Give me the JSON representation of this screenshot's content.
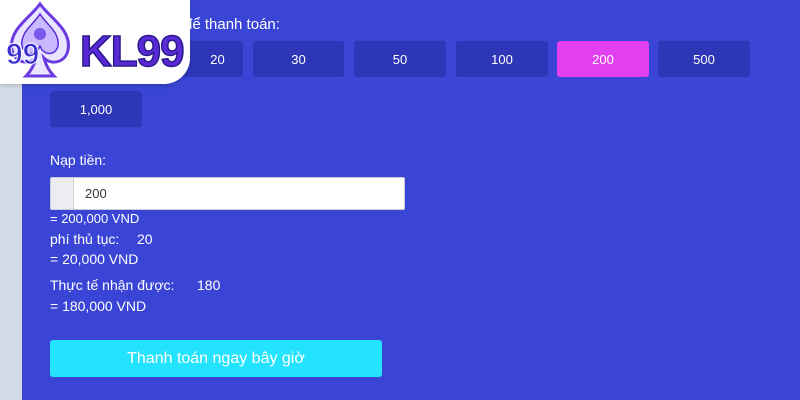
{
  "logo": {
    "brand_text": "KL99",
    "badge_text": "99"
  },
  "payment": {
    "section_title": "để thanh toán:",
    "amount_options": [
      "20",
      "30",
      "50",
      "100",
      "200",
      "500",
      "1,000"
    ],
    "selected_amount": "200"
  },
  "deposit": {
    "label": "Nạp tiền:",
    "input_value": "200",
    "converted": "= 200,000 VND"
  },
  "fee": {
    "label": "phí thủ tục:",
    "value": "20",
    "converted": "= 20,000 VND"
  },
  "received": {
    "label": "Thực tế nhận được:",
    "value": "180",
    "converted": "= 180,000 VND"
  },
  "pay_button_label": "Thanh toán ngay bây giờ",
  "colors": {
    "panel_bg": "#3a45d6",
    "button_bg": "#2e36b8",
    "selected_bg": "#e23ff0",
    "pay_button_bg": "#24e3ff",
    "logo_purple": "#5a2ad6"
  }
}
